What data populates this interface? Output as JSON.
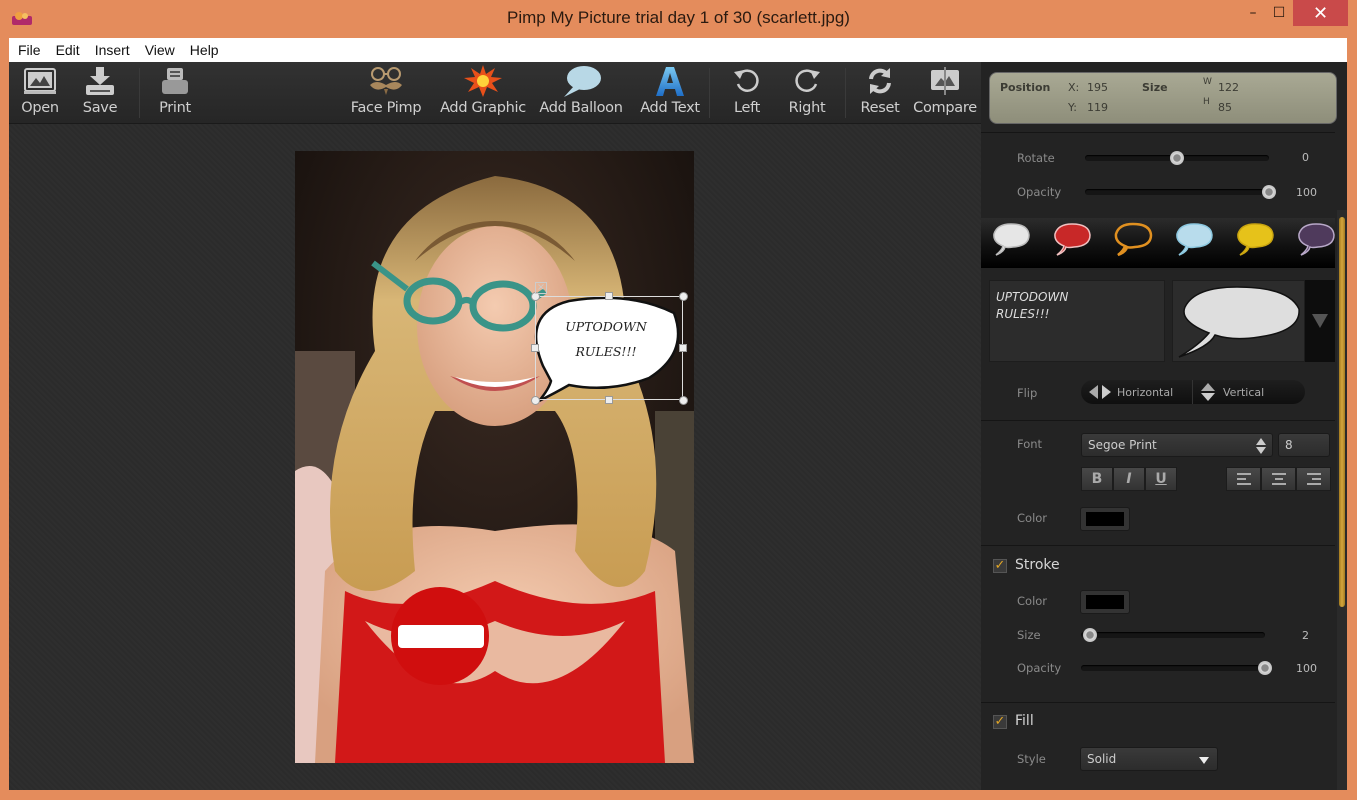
{
  "window": {
    "title": "Pimp My Picture trial day 1 of 30 (scarlett.jpg)",
    "controls": {
      "minimize": "–",
      "maximize": "☐",
      "close": "✕"
    }
  },
  "menu": [
    "File",
    "Edit",
    "Insert",
    "View",
    "Help"
  ],
  "toolbar": {
    "open": "Open",
    "save": "Save",
    "print": "Print",
    "face_pimp": "Face Pimp",
    "add_graphic": "Add Graphic",
    "add_balloon": "Add Balloon",
    "add_text": "Add Text",
    "left": "Left",
    "right": "Right",
    "reset": "Reset",
    "compare": "Compare"
  },
  "canvas": {
    "image_description": "Photo of a smiling blonde woman in a red dress",
    "overlays": [
      "teal cat-eye glasses",
      "speech balloon",
      "no-entry sign"
    ],
    "balloon_text_line1": "UPTODOWN",
    "balloon_text_line2": "RULES!!!"
  },
  "properties": {
    "position_label": "Position",
    "x_label": "X:",
    "x_value": "195",
    "y_label": "Y:",
    "y_value": "119",
    "size_label": "Size",
    "w_label": "W",
    "w_value": "122",
    "h_label": "H",
    "h_value": "85",
    "rotate_label": "Rotate",
    "rotate_value": "0",
    "rotate_fraction": 0.5,
    "opacity_label": "Opacity",
    "opacity_value": "100",
    "opacity_fraction": 1.0,
    "balloon_styles": [
      {
        "name": "white",
        "fill": "#e6e6e6",
        "stroke": "#bbbbbb"
      },
      {
        "name": "red",
        "fill": "#c82828",
        "stroke": "#f0c0c0"
      },
      {
        "name": "orange-outline",
        "fill": "none",
        "stroke": "#e09020"
      },
      {
        "name": "light-blue",
        "fill": "#b8dcec",
        "stroke": "#8cc8e0"
      },
      {
        "name": "yellow",
        "fill": "#e6c21a",
        "stroke": "#c9a410"
      },
      {
        "name": "purple",
        "fill": "#4f3a5c",
        "stroke": "#b8a8c8"
      }
    ],
    "text_value": "UPTODOWN\nRULES!!!",
    "flip_label": "Flip",
    "flip_horizontal": "Horizontal",
    "flip_vertical": "Vertical",
    "font_label": "Font",
    "font_value": "Segoe Print",
    "font_size": "8",
    "bold": "B",
    "italic": "I",
    "underline": "U",
    "color_label": "Color",
    "text_color": "#000000",
    "stroke": {
      "title": "Stroke",
      "checked": true,
      "color_label": "Color",
      "color": "#000000",
      "size_label": "Size",
      "size_value": "2",
      "size_fraction": 0.05,
      "opacity_label": "Opacity",
      "opacity_value": "100",
      "opacity_fraction": 1.0
    },
    "fill": {
      "title": "Fill",
      "checked": true,
      "style_label": "Style",
      "style_value": "Solid"
    }
  },
  "colors": {
    "window_frame": "#e48c5c",
    "accent": "#d3a63d",
    "close_button": "#c94a4a"
  }
}
